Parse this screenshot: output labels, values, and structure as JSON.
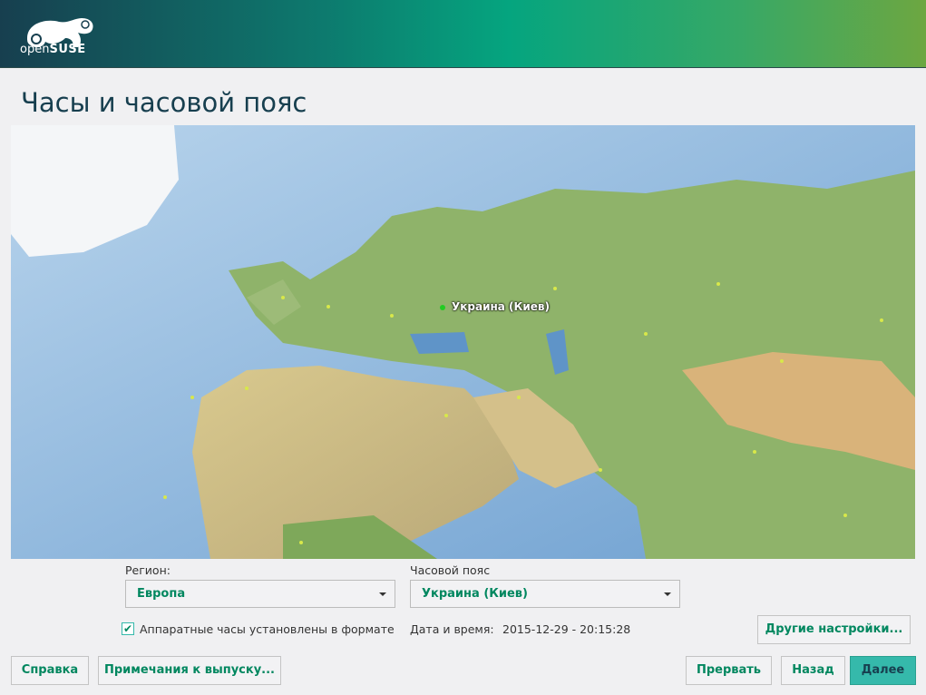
{
  "header": {
    "logo_text_light": "open",
    "logo_text_bold": "SUSE"
  },
  "page": {
    "title": "Часы и часовой пояс"
  },
  "map": {
    "selected_city_label": "Украина (Киев)",
    "marker_color": "#22cc22",
    "city_dot_color": "#d8e84a"
  },
  "form": {
    "region_label": "Регион:",
    "region_value": "Европа",
    "timezone_label": "Часовой пояс",
    "timezone_value": "Украина (Киев)",
    "hw_clock_label": "Аппаратные часы установлены в формате",
    "hw_clock_checked": true,
    "datetime_label": "Дата и время:",
    "datetime_value": "2015-12-29 - 20:15:28",
    "other_settings": "Другие настройки..."
  },
  "footer": {
    "help": "Справка",
    "release_notes": "Примечания к выпуску...",
    "abort": "Прервать",
    "back": "Назад",
    "next": "Далее"
  },
  "colors": {
    "accent": "#00875f",
    "primary_button": "#35b9ab",
    "title": "#173f4f"
  }
}
